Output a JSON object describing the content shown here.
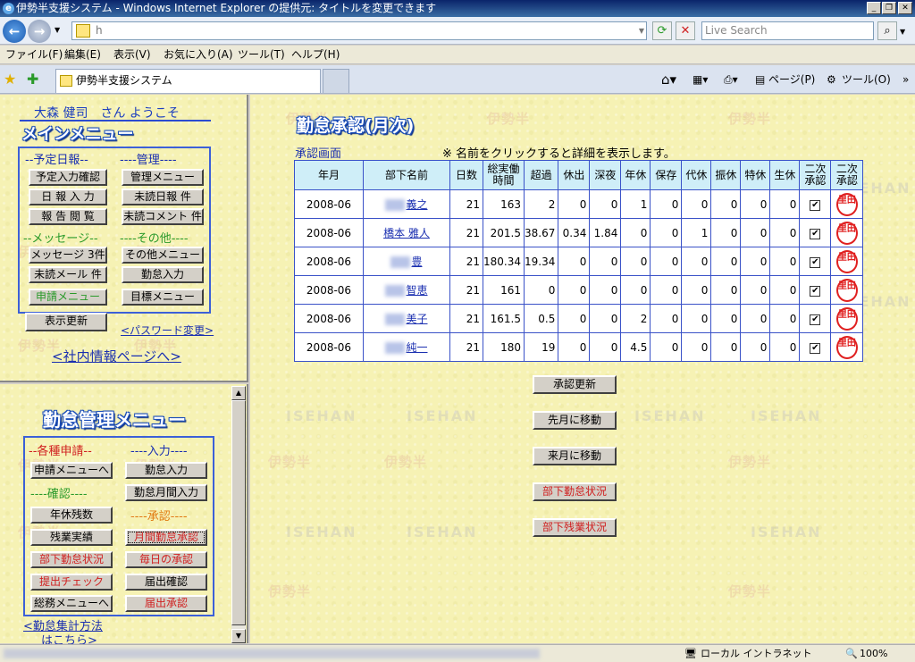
{
  "window": {
    "title": "伊勢半支援システム - Windows Internet Explorer の提供元: タイトルを変更できます"
  },
  "browser": {
    "address": "h",
    "search_placeholder": "Live Search",
    "menu": [
      "ファイル(F)",
      "編集(E)",
      "表示(V)",
      "お気に入り(A)",
      "ツール(T)",
      "ヘルプ(H)"
    ],
    "tab_title": "伊勢半支援システム",
    "toolbar": {
      "page": "ページ(P)",
      "tools": "ツール(O)"
    },
    "status_zone": "ローカル イントラネット",
    "zoom": "100%"
  },
  "left": {
    "welcome": "大森 健司　さん ようこそ",
    "main_menu_title": "メインメニュー",
    "grp_schedule": "--予定日報--",
    "grp_manage": "----管理----",
    "grp_message": "--メッセージ--",
    "grp_other": "----その他----",
    "btn_schedule_confirm": "予定入力確認",
    "btn_daily_input": "日 報 入 力",
    "btn_report_view": "報 告 閲 覧",
    "btn_manage_menu": "管理メニュー",
    "btn_unread_daily": "未読日報 件",
    "btn_unread_comment": "未読コメント 件",
    "btn_message": "メッセージ 3件",
    "btn_unread_mail": "未読メール 件",
    "btn_apply_menu": "申請メニュー",
    "btn_other_menu": "その他メニュー",
    "btn_attendance_input": "勤怠入力",
    "btn_goal_menu": "目標メニュー",
    "btn_refresh": "表示更新",
    "link_password": "<パスワード変更>",
    "link_intranet": "<社内情報ページへ>"
  },
  "attendance_menu": {
    "title": "勤怠管理メニュー",
    "grp_apply": "--各種申請--",
    "grp_input": "----入力----",
    "grp_confirm": "----確認----",
    "grp_approve": "----承認----",
    "btn_to_apply_menu": "申請メニューへ",
    "btn_attendance_input": "勤怠入力",
    "btn_monthly_input": "勤怠月間入力",
    "btn_leave_balance": "年休残数",
    "btn_overtime_record": "残業実績",
    "btn_monthly_approve": "月間勤怠承認",
    "btn_sub_status": "部下勤怠状況",
    "btn_daily_approve": "毎日の承認",
    "btn_submit_check": "提出チェック",
    "btn_notice_confirm": "届出確認",
    "btn_to_general_menu": "総務メニューへ",
    "btn_notice_approve": "届出承認",
    "link_calc_method": "<勤怠集計方法",
    "link_calc_method2": "はこちら>"
  },
  "main": {
    "title": "勤怠承認(月次)",
    "screen_label": "承認画面",
    "note": "※ 名前をクリックすると詳細を表示します。",
    "headers": [
      "年月",
      "部下名前",
      "日数",
      "総実働時間",
      "超過",
      "休出",
      "深夜",
      "年休",
      "保存",
      "代休",
      "振休",
      "特休",
      "生休",
      "二次承認",
      "二次承認"
    ],
    "rows": [
      {
        "ym": "2008-06",
        "name": "義之",
        "days": "21",
        "total": "163",
        "over": "2",
        "holiday_work": "0",
        "late_night": "0",
        "annual": "1",
        "reserved": "0",
        "comp": "0",
        "transfer": "0",
        "special": "0",
        "menstrual": "0",
        "stamp": "里田"
      },
      {
        "ym": "2008-06",
        "name": "橋本 雅人",
        "days": "21",
        "total": "201.5",
        "over": "38.67",
        "holiday_work": "0.34",
        "late_night": "1.84",
        "annual": "0",
        "reserved": "0",
        "comp": "1",
        "transfer": "0",
        "special": "0",
        "menstrual": "0",
        "stamp": "里田"
      },
      {
        "ym": "2008-06",
        "name": "豊",
        "days": "21",
        "total": "180.34",
        "over": "19.34",
        "holiday_work": "0",
        "late_night": "0",
        "annual": "0",
        "reserved": "0",
        "comp": "0",
        "transfer": "0",
        "special": "0",
        "menstrual": "0",
        "stamp": "里田"
      },
      {
        "ym": "2008-06",
        "name": "智恵",
        "days": "21",
        "total": "161",
        "over": "0",
        "holiday_work": "0",
        "late_night": "0",
        "annual": "0",
        "reserved": "0",
        "comp": "0",
        "transfer": "0",
        "special": "0",
        "menstrual": "0",
        "stamp": "里田"
      },
      {
        "ym": "2008-06",
        "name": "美子",
        "days": "21",
        "total": "161.5",
        "over": "0.5",
        "holiday_work": "0",
        "late_night": "0",
        "annual": "2",
        "reserved": "0",
        "comp": "0",
        "transfer": "0",
        "special": "0",
        "menstrual": "0",
        "stamp": "里田"
      },
      {
        "ym": "2008-06",
        "name": "純一",
        "days": "21",
        "total": "180",
        "over": "19",
        "holiday_work": "0",
        "late_night": "0",
        "annual": "4.5",
        "reserved": "0",
        "comp": "0",
        "transfer": "0",
        "special": "0",
        "menstrual": "0",
        "stamp": "里田"
      }
    ],
    "btn_approve_update": "承認更新",
    "btn_prev_month": "先月に移動",
    "btn_next_month": "来月に移動",
    "btn_sub_attendance": "部下勤怠状況",
    "btn_sub_overtime": "部下残業状況"
  },
  "watermarks": [
    "伊勢半",
    "ISEHAN"
  ]
}
